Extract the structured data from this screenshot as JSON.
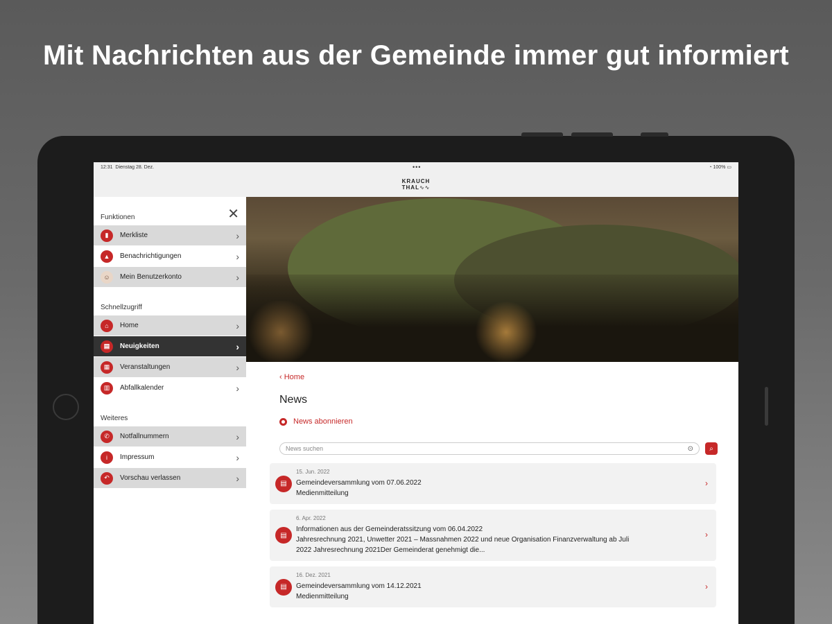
{
  "headline": "Mit Nachrichten aus der Gemeinde immer gut informiert",
  "status": {
    "time": "12:31",
    "date": "Dienstag 28. Dez.",
    "battery": "100%"
  },
  "logo": {
    "line1": "KRAUCH",
    "line2": "THAL"
  },
  "sidebar": {
    "sections": [
      {
        "title": "Funktionen",
        "items": [
          {
            "label": "Merkliste",
            "icon": "bookmark-icon"
          },
          {
            "label": "Benachrichtigungen",
            "icon": "bell-icon"
          },
          {
            "label": "Mein Benutzerkonto",
            "icon": "avatar-icon"
          }
        ]
      },
      {
        "title": "Schnellzugriff",
        "items": [
          {
            "label": "Home",
            "icon": "home-icon"
          },
          {
            "label": "Neuigkeiten",
            "icon": "news-icon",
            "active": true
          },
          {
            "label": "Veranstaltungen",
            "icon": "calendar-icon"
          },
          {
            "label": "Abfallkalender",
            "icon": "trash-icon"
          }
        ]
      },
      {
        "title": "Weiteres",
        "items": [
          {
            "label": "Notfallnummern",
            "icon": "phone-icon"
          },
          {
            "label": "Impressum",
            "icon": "info-icon"
          },
          {
            "label": "Vorschau verlassen",
            "icon": "exit-icon"
          }
        ]
      }
    ]
  },
  "main": {
    "back_label": "Home",
    "title": "News",
    "subscribe_label": "News abonnieren",
    "search_placeholder": "News suchen",
    "news": [
      {
        "date": "15. Jun. 2022",
        "title": "Gemeindeversammlung vom 07.06.2022",
        "lines": [
          "Medienmitteilung"
        ]
      },
      {
        "date": "6. Apr. 2022",
        "title": "Informationen aus der Gemeinderatssitzung vom 06.04.2022",
        "lines": [
          "Jahresrechnung 2021, Unwetter 2021 – Massnahmen 2022 und neue Organisation Finanzverwaltung ab Juli",
          "2022 Jahresrechnung 2021Der Gemeinderat genehmigt die..."
        ]
      },
      {
        "date": "16. Dez. 2021",
        "title": "Gemeindeversammlung vom 14.12.2021",
        "lines": [
          "Medienmitteilung"
        ]
      }
    ]
  },
  "colors": {
    "accent": "#c62828",
    "active_bg": "#333333",
    "item_bg": "#d9d9d9"
  }
}
